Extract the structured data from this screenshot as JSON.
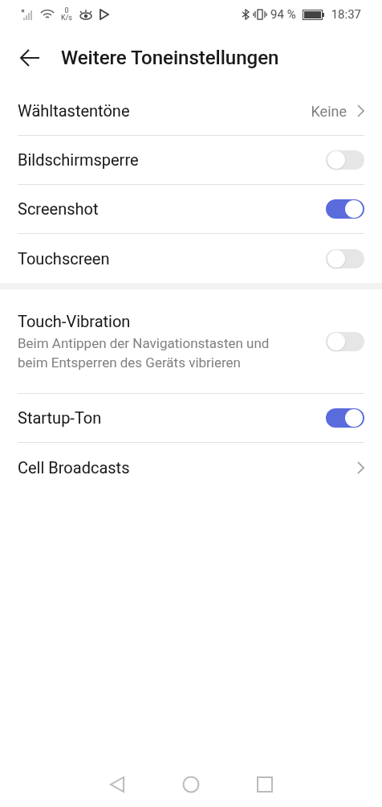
{
  "status_bar": {
    "net_speed_value": "0",
    "net_speed_unit": "K/s",
    "battery": "94 %",
    "time": "18:37"
  },
  "header": {
    "title": "Weitere Toneinstellungen"
  },
  "sections": [
    {
      "items": [
        {
          "kind": "link",
          "label": "Wähltastentöne",
          "value": "Keine"
        },
        {
          "kind": "toggle",
          "label": "Bildschirmsperre",
          "on": false
        },
        {
          "kind": "toggle",
          "label": "Screenshot",
          "on": true
        },
        {
          "kind": "toggle",
          "label": "Touchscreen",
          "on": false
        }
      ]
    },
    {
      "items": [
        {
          "kind": "toggle",
          "label": "Touch-Vibration",
          "description": "Beim Antippen der Navigationstasten und beim Entsperren des Geräts vibrieren",
          "on": false
        },
        {
          "kind": "toggle",
          "label": "Startup-Ton",
          "on": true
        },
        {
          "kind": "link",
          "label": "Cell Broadcasts"
        }
      ]
    }
  ]
}
